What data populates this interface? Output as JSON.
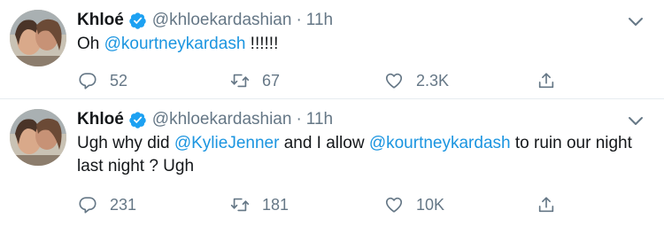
{
  "tweets": [
    {
      "name": "Khloé",
      "handle": "@khloekardashian",
      "separator": "·",
      "time": "11h",
      "text_parts": [
        "Oh ",
        "@kourtneykardash",
        " !!!!!!"
      ],
      "replies": "52",
      "retweets": "67",
      "likes": "2.3K"
    },
    {
      "name": "Khloé",
      "handle": "@khloekardashian",
      "separator": "·",
      "time": "11h",
      "text_parts": [
        "Ugh why did ",
        "@KylieJenner",
        " and I allow ",
        "@kourtneykardash",
        " to ruin our night last night ? Ugh"
      ],
      "replies": "231",
      "retweets": "181",
      "likes": "10K"
    }
  ],
  "icons": {
    "verified": "verified-badge-icon",
    "caret": "chevron-down-icon",
    "reply": "reply-icon",
    "retweet": "retweet-icon",
    "like": "heart-icon",
    "share": "share-icon"
  },
  "colors": {
    "text": "#14171a",
    "secondary": "#657786",
    "link": "#1b95e0",
    "verified": "#1da1f2",
    "divider": "#e6ecf0"
  }
}
